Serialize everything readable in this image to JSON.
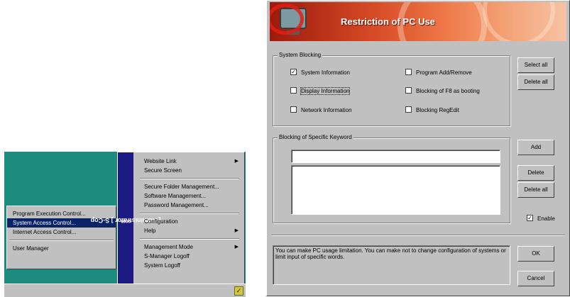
{
  "taskbar_menu": {
    "submenu_items": [
      {
        "label": "Program Execution Control..."
      },
      {
        "label": "System Access Control..."
      },
      {
        "label": "Internet Access Control..."
      },
      {
        "label": "User Manager"
      }
    ],
    "banner_text": "[ Administrator ] S-Cop",
    "banner_suffix": "2000",
    "menu_items": [
      {
        "label": "Website Link"
      },
      {
        "label": "Secure Screen"
      },
      {
        "label": "Secure Folder Management..."
      },
      {
        "label": "Software Management..."
      },
      {
        "label": "Password Management..."
      },
      {
        "label": "Configuration"
      },
      {
        "label": "Help"
      },
      {
        "label": "Management Mode"
      },
      {
        "label": "S-Manager Logoff"
      },
      {
        "label": "System Logoff"
      }
    ]
  },
  "dialog": {
    "title": "Restriction of PC Use",
    "system_blocking": {
      "legend": "System Blocking",
      "options": [
        {
          "label": "System Information",
          "checked": true
        },
        {
          "label": "Display Information",
          "checked": false
        },
        {
          "label": "Network Information",
          "checked": false
        },
        {
          "label": "Program Add/Remove",
          "checked": false
        },
        {
          "label": "Blocking of F8 as booting",
          "checked": false
        },
        {
          "label": "Blocking RegEdit",
          "checked": false
        }
      ],
      "select_all_label": "Select all",
      "delete_all_label": "Delete all"
    },
    "keyword": {
      "legend": "Blocking of Specific Keyword",
      "input_value": "",
      "add_label": "Add",
      "delete_label": "Delete",
      "delete_all_label": "Delete all",
      "enable_label": "Enable",
      "enable_checked": true
    },
    "info_text": "You can make PC usage limitation. You can make not to change configuration of systems or limit input of specific words.",
    "ok_label": "OK",
    "cancel_label": "Cancel"
  },
  "colors": {
    "desktop": "#1d8c80",
    "highlight": "#0a246a",
    "banner": "#d64a26"
  }
}
